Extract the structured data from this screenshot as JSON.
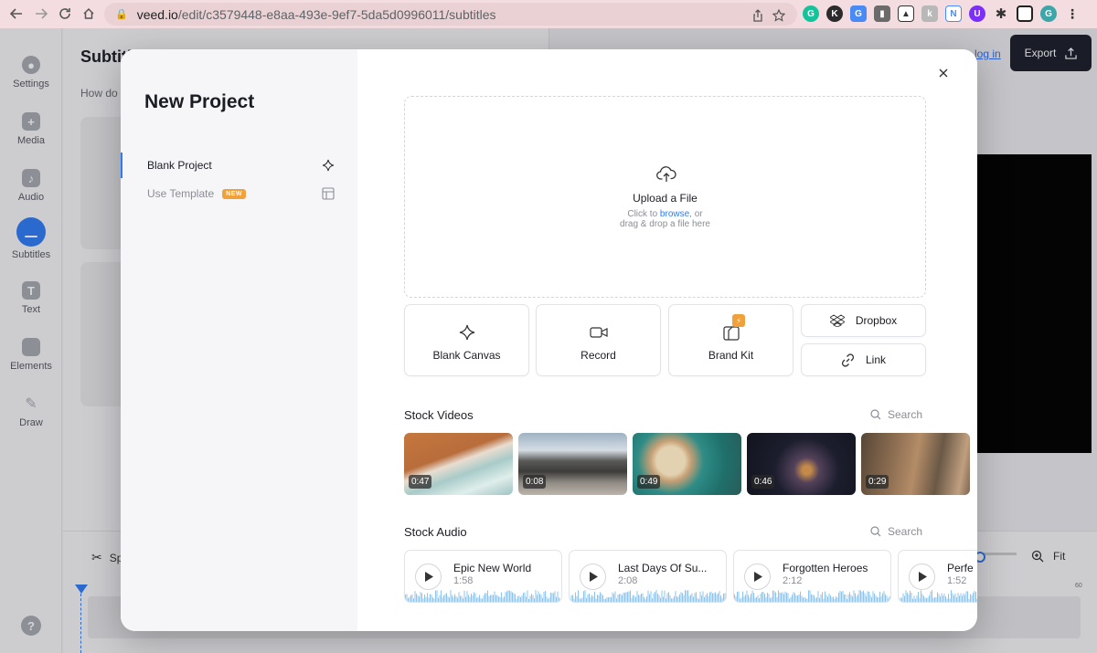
{
  "browser": {
    "url_host": "veed.io",
    "url_path": "/edit/c3579448-e8aa-493e-9ef7-5da5d0996011/subtitles",
    "profile_initial": "G"
  },
  "sidebar": {
    "items": [
      {
        "label": "Settings"
      },
      {
        "label": "Media"
      },
      {
        "label": "Audio"
      },
      {
        "label": "Subtitles"
      },
      {
        "label": "Text"
      },
      {
        "label": "Elements"
      },
      {
        "label": "Draw"
      }
    ],
    "help": "?"
  },
  "background": {
    "panel_title": "Subtitl",
    "panel_subtitle": "How do y",
    "login_link": "log in",
    "export_label": "Export",
    "timeline_split": "Sp",
    "timeline_fit": "Fit",
    "timeline_marker": "60"
  },
  "modal": {
    "title": "New Project",
    "menu": [
      {
        "label": "Blank Project",
        "active": true
      },
      {
        "label": "Use Template",
        "badge": "NEW"
      }
    ],
    "upload": {
      "title": "Upload a File",
      "hint_prefix": "Click to ",
      "hint_link": "browse",
      "hint_suffix": ", or",
      "hint_line2": "drag & drop a file here"
    },
    "tiles": [
      {
        "label": "Blank Canvas",
        "icon": "sparkle-icon"
      },
      {
        "label": "Record",
        "icon": "video-camera-icon"
      },
      {
        "label": "Brand Kit",
        "icon": "brand-kit-icon",
        "badge": "⚡"
      }
    ],
    "small_tiles": [
      {
        "label": "Dropbox",
        "icon": "dropbox-icon"
      },
      {
        "label": "Link",
        "icon": "link-icon"
      }
    ],
    "stock_videos": {
      "title": "Stock Videos",
      "search": "Search",
      "items": [
        {
          "duration": "0:47"
        },
        {
          "duration": "0:08"
        },
        {
          "duration": "0:49"
        },
        {
          "duration": "0:46"
        },
        {
          "duration": "0:29"
        }
      ]
    },
    "stock_audio": {
      "title": "Stock Audio",
      "search": "Search",
      "items": [
        {
          "title": "Epic New World",
          "duration": "1:58"
        },
        {
          "title": "Last Days Of Su...",
          "duration": "2:08"
        },
        {
          "title": "Forgotten Heroes",
          "duration": "2:12"
        },
        {
          "title": "Perfe",
          "duration": "1:52"
        }
      ]
    }
  },
  "colors": {
    "accent": "#2f7cf6",
    "badge_orange": "#f0a13b",
    "waveform": "#8ec5ef"
  }
}
